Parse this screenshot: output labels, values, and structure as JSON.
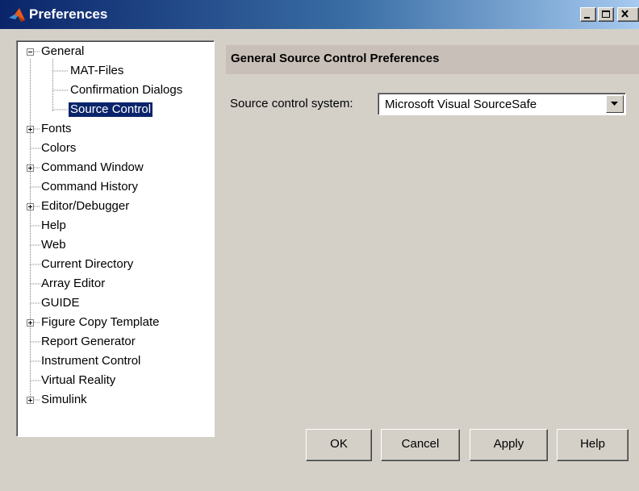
{
  "window": {
    "title": "Preferences",
    "icon": "matlab-logo-icon",
    "controls": [
      "minimize-icon",
      "maximize-icon",
      "close-icon"
    ]
  },
  "tree": {
    "items": [
      {
        "label": "General",
        "expander": "minus"
      },
      {
        "label": "MAT-Files",
        "expander": null
      },
      {
        "label": "Confirmation Dialogs",
        "expander": null
      },
      {
        "label": "Source Control",
        "expander": null,
        "selected": true
      },
      {
        "label": "Fonts",
        "expander": "plus"
      },
      {
        "label": "Colors",
        "expander": null
      },
      {
        "label": "Command Window",
        "expander": "plus"
      },
      {
        "label": "Command History",
        "expander": null
      },
      {
        "label": "Editor/Debugger",
        "expander": "plus"
      },
      {
        "label": "Help",
        "expander": null
      },
      {
        "label": "Web",
        "expander": null
      },
      {
        "label": "Current Directory",
        "expander": null
      },
      {
        "label": "Array Editor",
        "expander": null
      },
      {
        "label": "GUIDE",
        "expander": null
      },
      {
        "label": "Figure Copy Template",
        "expander": "plus"
      },
      {
        "label": "Report Generator",
        "expander": null
      },
      {
        "label": "Instrument Control",
        "expander": null
      },
      {
        "label": "Virtual Reality",
        "expander": null
      },
      {
        "label": "Simulink",
        "expander": "plus"
      }
    ]
  },
  "panel": {
    "header": "General Source Control Preferences",
    "source_label": "Source control system:",
    "source_value": "Microsoft Visual SourceSafe"
  },
  "buttons": {
    "ok": "OK",
    "cancel": "Cancel",
    "apply": "Apply",
    "help": "Help"
  },
  "colors": {
    "selection": "#0a246a",
    "titlebar_start": "#0a246a",
    "titlebar_end": "#a6caf0",
    "header_bg": "#c8c0b8",
    "face": "#d4d0c8"
  }
}
